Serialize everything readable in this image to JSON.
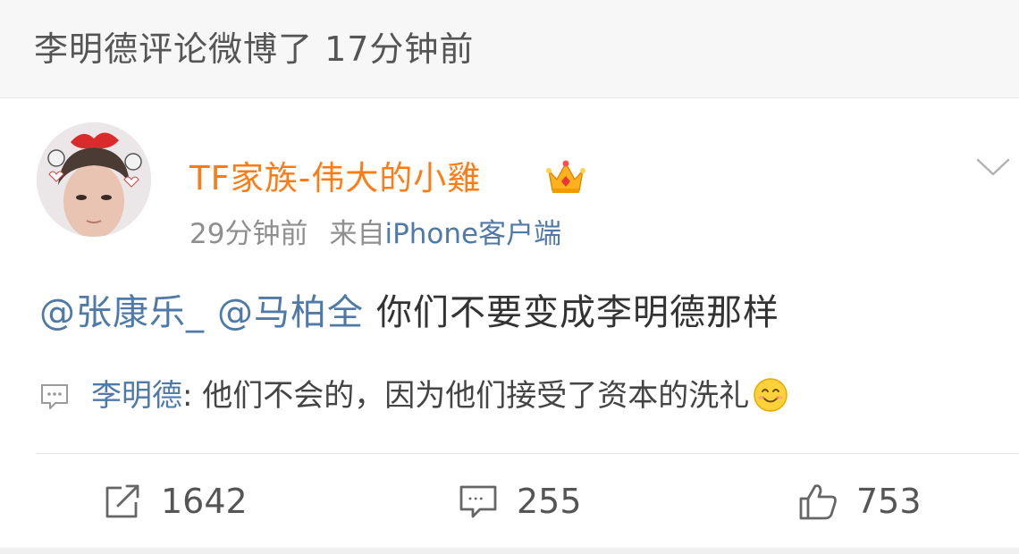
{
  "notice": {
    "text": "李明德评论微博了 17分钟前"
  },
  "post": {
    "user_name": "TF家族-伟大的小雞",
    "time": "29分钟前",
    "source_prefix": "来自",
    "source_app": "iPhone客户端",
    "mention_1": "@张康乐_",
    "mention_2": "@马柏全",
    "content": "你们不要变成李明德那样",
    "comment_author": "李明德",
    "comment_separator": ": ",
    "comment_text": "他们不会的，因为他们接受了资本的洗礼",
    "comment_emoji": "smile-emoji"
  },
  "actions": {
    "repost_count": "1642",
    "comment_count": "255",
    "like_count": "753"
  },
  "icons": {
    "crown": "crown-icon",
    "menu": "chevron-down-icon",
    "comment": "comment-bubble-icon",
    "repost": "repost-icon",
    "like": "thumbs-up-icon"
  },
  "colors": {
    "username": "#ff7b15",
    "link": "#4f7aa8",
    "meta": "#8f8f8f",
    "notice_bg": "#f7f7f7"
  }
}
